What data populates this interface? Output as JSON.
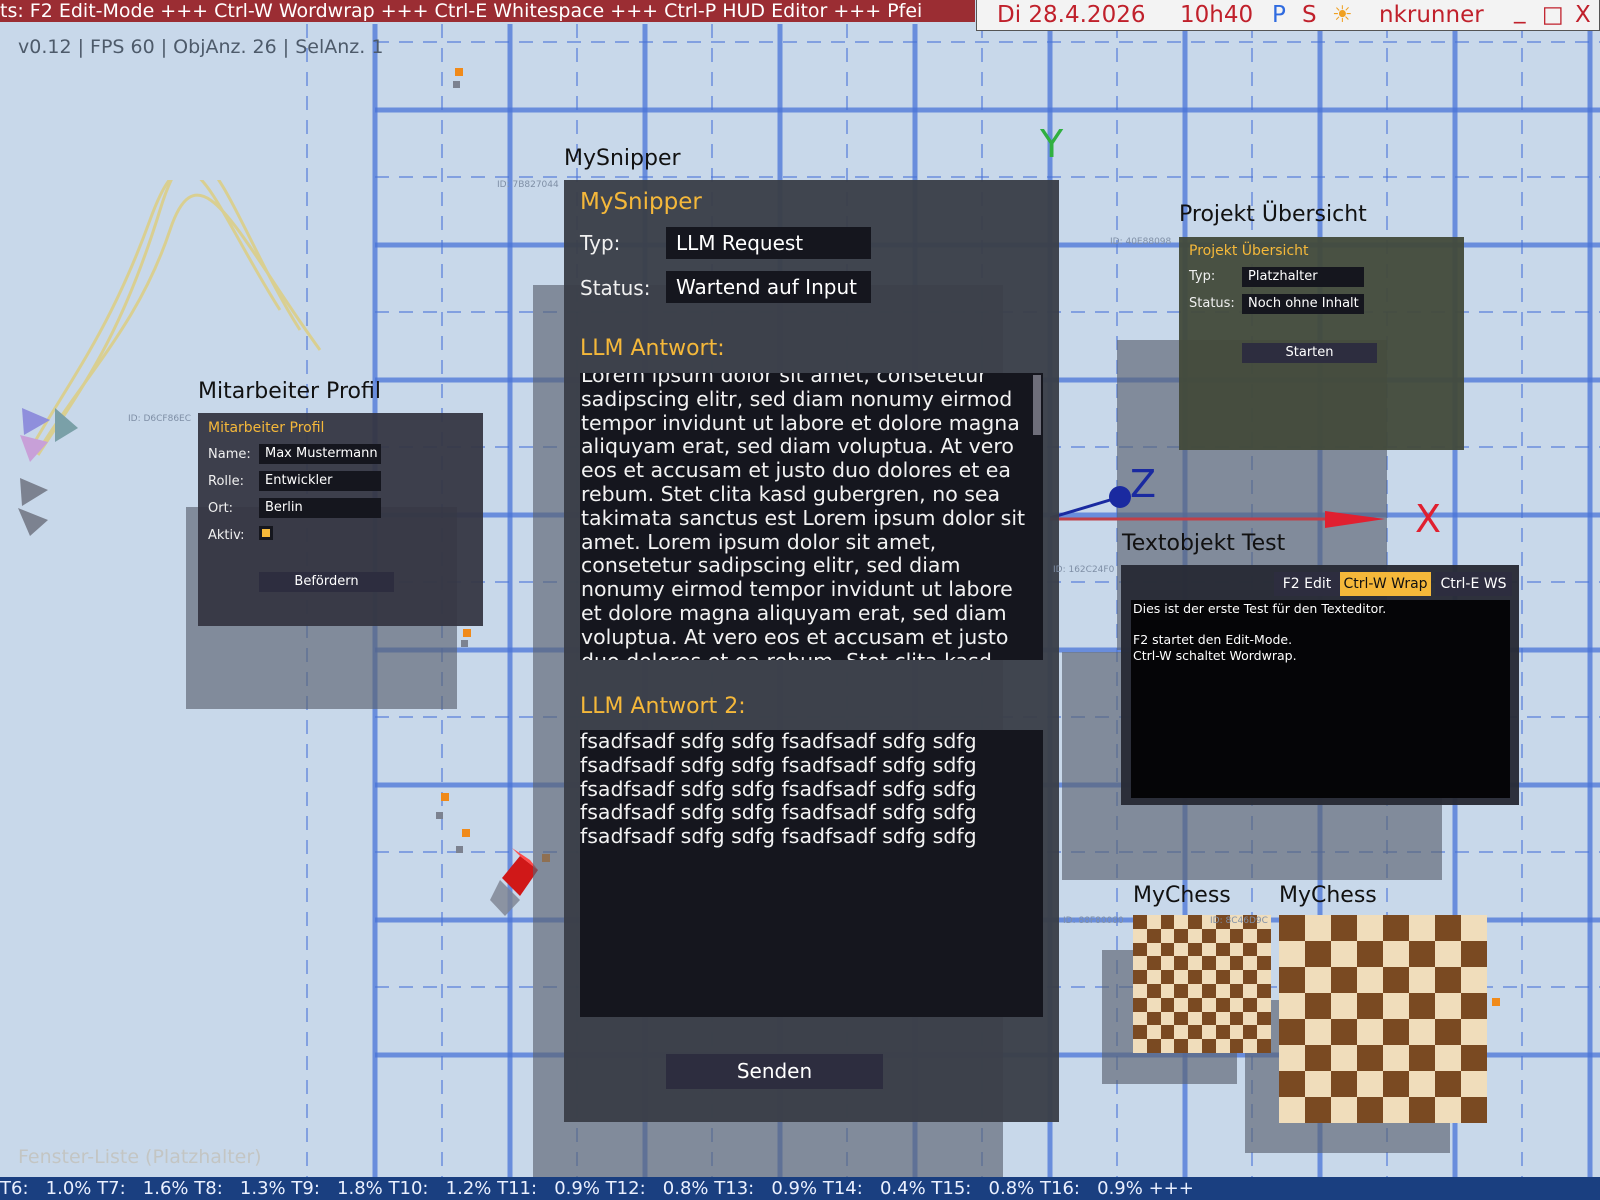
{
  "ticker": "ts: F2 Edit-Mode +++ Ctrl-W Wordwrap +++ Ctrl-E Whitespace +++ Ctrl-P HUD Editor +++ Pfei",
  "tray": {
    "datetime": "Di 28.4.2026",
    "time": "10h40",
    "p": "P",
    "s": "S",
    "sun": "☀",
    "user": "nkrunner",
    "min": "_",
    "max": "□",
    "close": "X"
  },
  "stats": "v0.12 | FPS 60 | ObjAnz. 26 | SelAnz. 1",
  "axes": {
    "x": "X",
    "y": "Y",
    "z": "Z"
  },
  "mitarbeiter": {
    "window_title": "Mitarbeiter Profil",
    "id": "ID: D6CF86EC",
    "title": "Mitarbeiter Profil",
    "name_label": "Name:",
    "name_value": "Max Mustermann",
    "rolle_label": "Rolle:",
    "rolle_value": "Entwickler",
    "ort_label": "Ort:",
    "ort_value": "Berlin",
    "aktiv_label": "Aktiv:",
    "button": "Befördern"
  },
  "snipper": {
    "window_title": "MySnipper",
    "id": "ID: 7B827044",
    "title": "MySnipper",
    "typ_label": "Typ:",
    "typ_value": "LLM Request",
    "status_label": "Status:",
    "status_value": "Wartend auf Input",
    "answer_heading": "LLM Antwort:",
    "answer_text": "Lorem ipsum dolor sit amet, consetetur sadipscing elitr, sed diam nonumy eirmod tempor invidunt ut labore et dolore magna aliquyam erat, sed diam voluptua. At vero eos et accusam et justo duo dolores et ea rebum. Stet clita kasd gubergren, no sea takimata sanctus est Lorem ipsum dolor sit amet. Lorem ipsum dolor sit amet, consetetur sadipscing elitr, sed diam nonumy eirmod tempor invidunt ut labore et dolore magna aliquyam erat, sed diam voluptua. At vero eos et accusam et justo duo dolores et ea rebum. Stet clita kasd",
    "answer2_heading": "LLM Antwort 2:",
    "answer2_lines": [
      "fsadfsadf sdfg sdfg fsadfsadf sdfg sdfg",
      "fsadfsadf sdfg sdfg fsadfsadf sdfg sdfg",
      "fsadfsadf sdfg sdfg fsadfsadf sdfg sdfg",
      "fsadfsadf sdfg sdfg fsadfsadf sdfg sdfg",
      "fsadfsadf sdfg sdfg fsadfsadf sdfg sdfg"
    ],
    "send_button": "Senden"
  },
  "projekt": {
    "window_title": "Projekt Übersicht",
    "id": "ID: 40E88098",
    "title": "Projekt Übersicht",
    "typ_label": "Typ:",
    "typ_value": "Platzhalter",
    "status_label": "Status:",
    "status_value": "Noch ohne Inhalt",
    "button": "Starten"
  },
  "textobjekt": {
    "window_title": "Textobjekt Test",
    "id": "ID: 162C24F0",
    "tab_edit": "F2 Edit",
    "tab_wrap": "Ctrl-W Wrap",
    "tab_ws": "Ctrl-E WS",
    "content": "Dies ist der erste Test für den Texteditor.\n\nF2 startet den Edit-Mode.\nCtrl-W schaltet Wordwrap."
  },
  "chess1": {
    "window_title": "MyChess",
    "id": "ID: 88F80080",
    "size": 10
  },
  "chess2": {
    "window_title": "MyChess",
    "id": "ID: 8C46D9C",
    "size": 8
  },
  "colors": {
    "ticker_bg": "#9b2d33",
    "accent_yellow": "#f5b83a",
    "grid_line": "#4a74d8",
    "chess_dark": "#7a4a22",
    "chess_light": "#f0ddbb",
    "axis_x": "#e02030",
    "axis_y": "#30b040",
    "axis_z": "#1a2aa0",
    "bottom_bar": "#1a3f80"
  },
  "window_list": "Fenster-Liste (Platzhalter)",
  "bottom_bar": "T6:   1.0% T7:   1.6% T8:   1.3% T9:   1.8% T10:   1.2% T11:   0.9% T12:   0.8% T13:   0.9% T14:   0.4% T15:   0.8% T16:   0.9% +++"
}
